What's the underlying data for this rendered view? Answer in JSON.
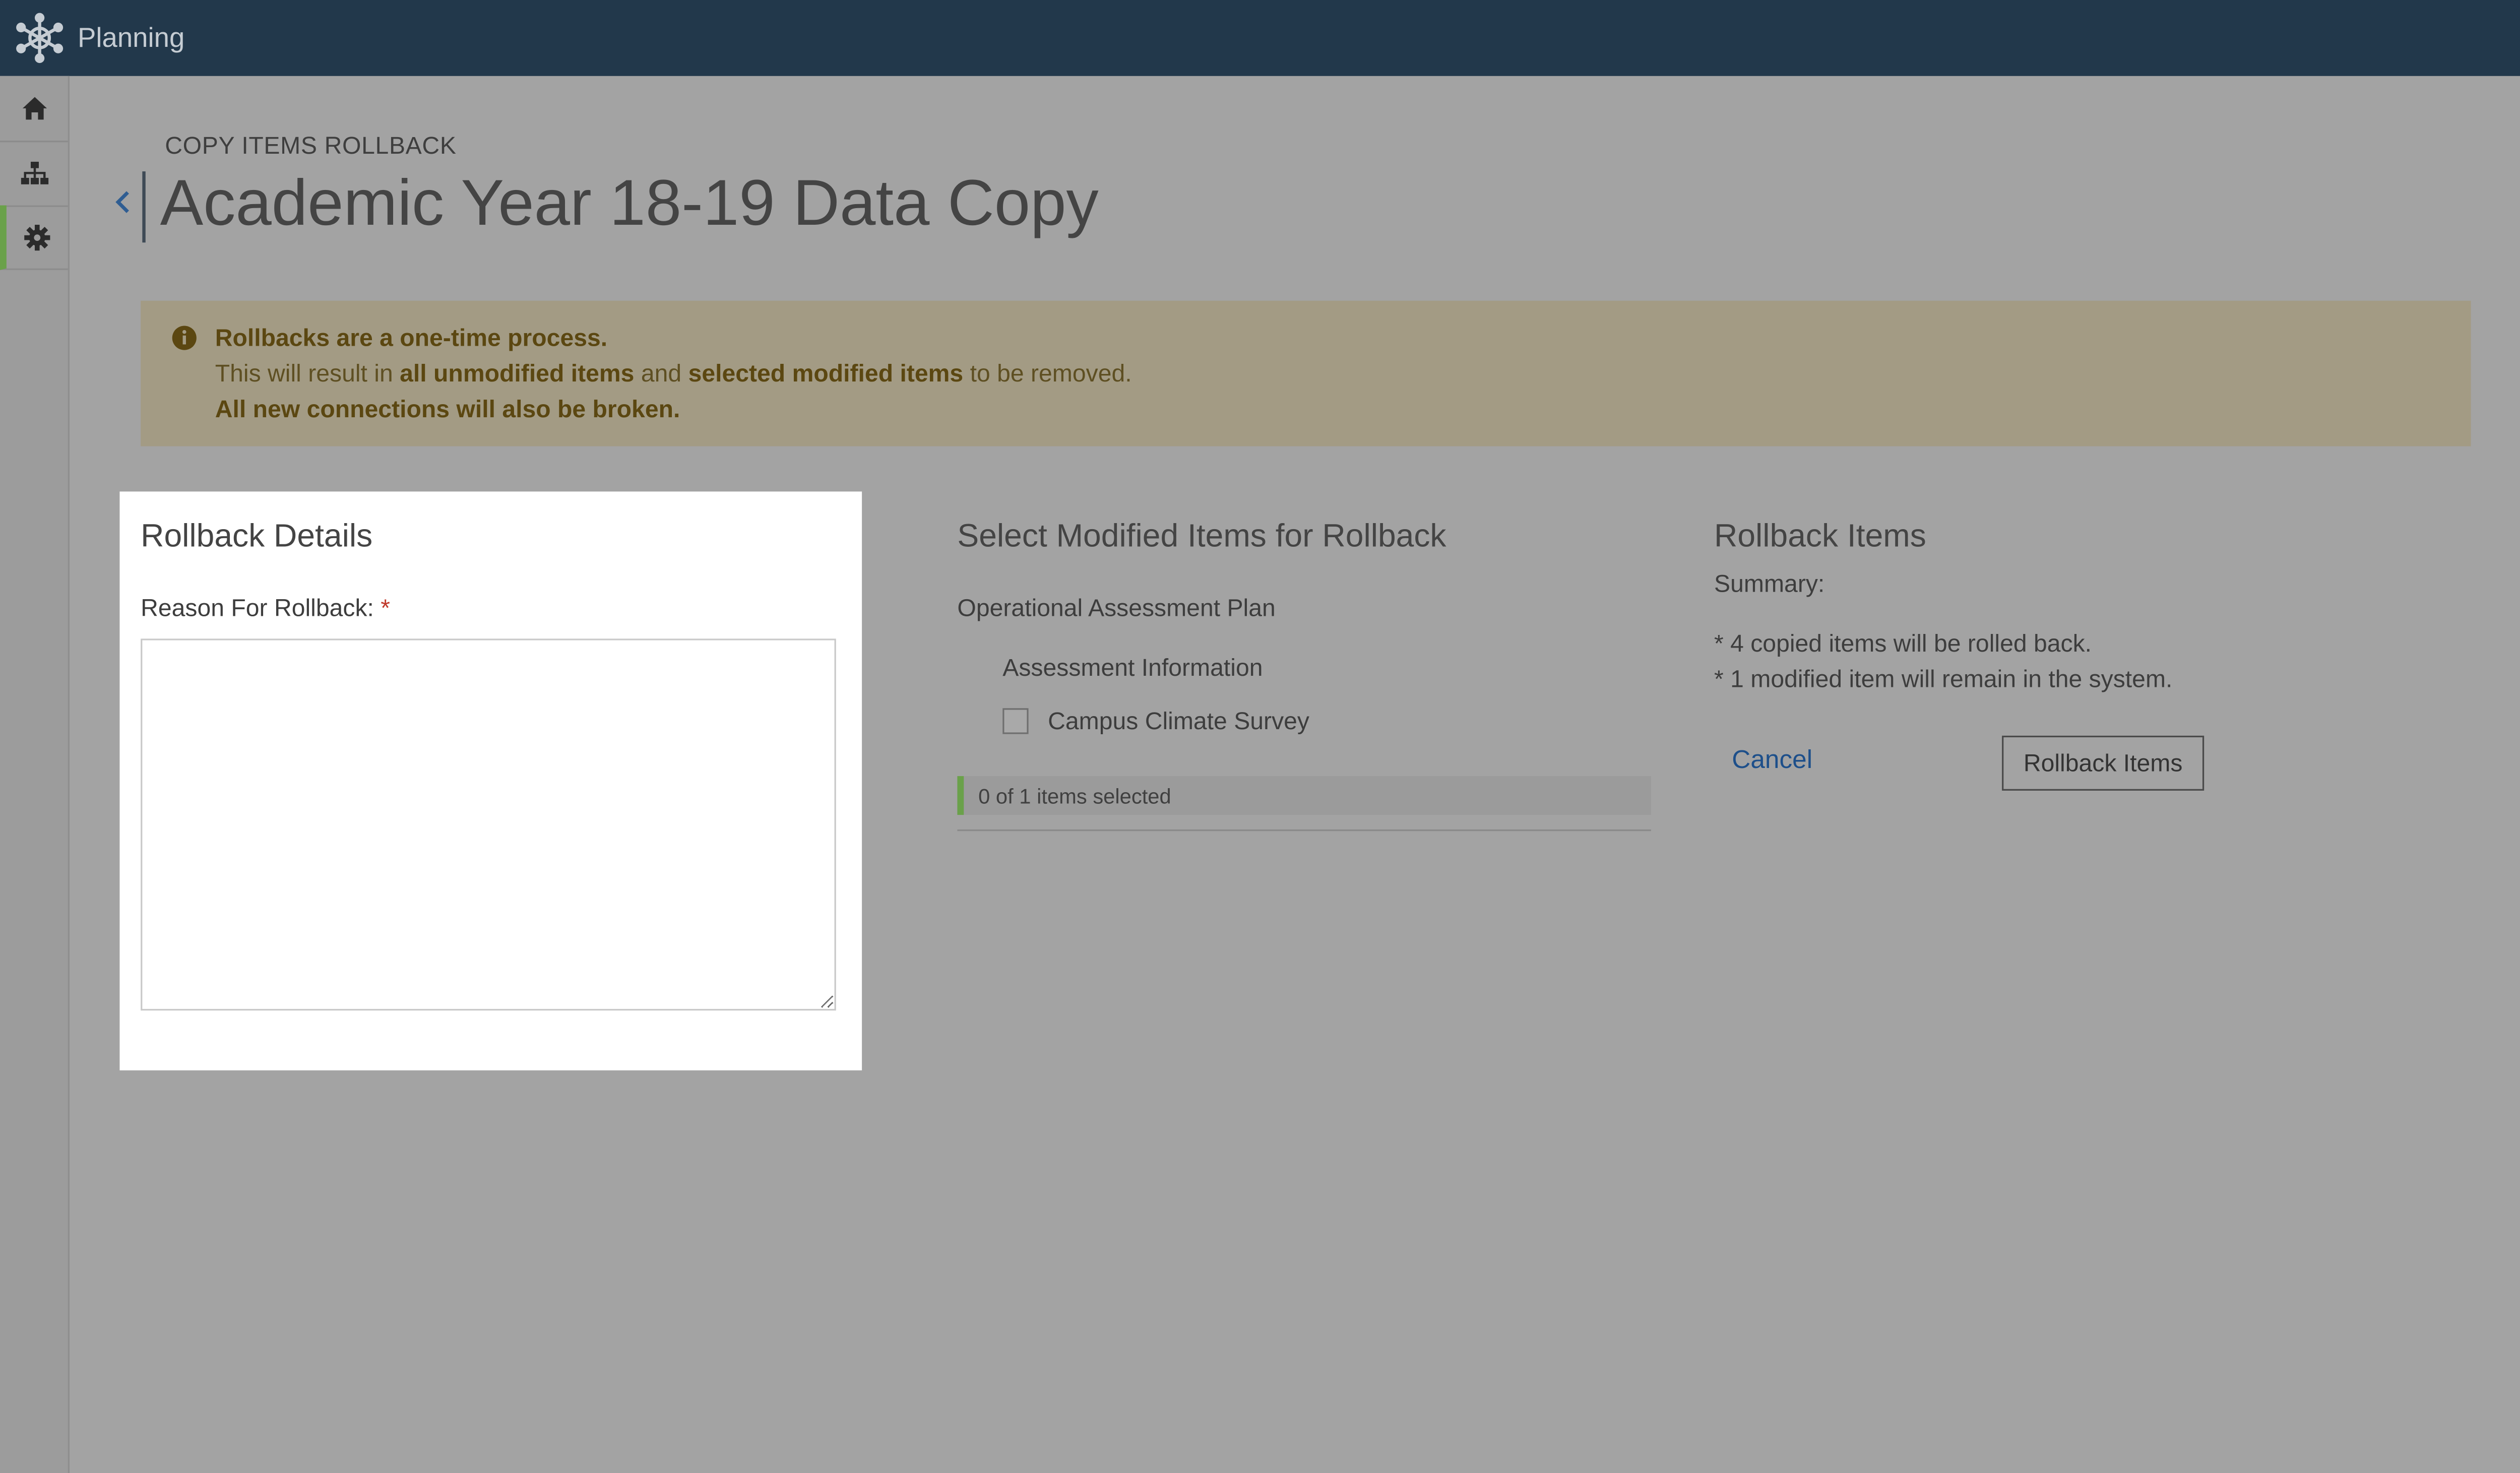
{
  "app": {
    "name": "Planning"
  },
  "sidebar": {
    "items": [
      {
        "icon": "home-icon",
        "active": false
      },
      {
        "icon": "sitemap-icon",
        "active": false
      },
      {
        "icon": "gear-icon",
        "active": true
      }
    ]
  },
  "page": {
    "breadcrumb": "COPY ITEMS ROLLBACK",
    "title": "Academic Year 18-19 Data Copy"
  },
  "alert": {
    "line1": "Rollbacks are a one-time process.",
    "line2_pre": "This will result in ",
    "line2_bold1": "all unmodified items",
    "line2_mid": " and ",
    "line2_bold2": "selected modified items",
    "line2_post": " to be removed.",
    "line3": "All new connections will also be broken."
  },
  "details": {
    "heading": "Rollback Details",
    "reason_label": "Reason For Rollback:",
    "required_mark": "*",
    "reason_value": ""
  },
  "select": {
    "heading": "Select Modified Items for Rollback",
    "group": "Operational Assessment Plan",
    "subgroup": "Assessment Information",
    "item": {
      "label": "Campus Climate Survey",
      "checked": false
    },
    "count_text": "0 of 1 items selected"
  },
  "summary": {
    "heading": "Rollback Items",
    "label": "Summary:",
    "line1": "* 4 copied items will be rolled back.",
    "line2": "* 1 modified item will remain in the system.",
    "cancel_label": "Cancel",
    "submit_label": "Rollback Items"
  },
  "colors": {
    "topbar": "#22384b",
    "accent_green": "#6aa14a",
    "link_blue": "#1d4f8a",
    "alert_bg": "#a39b84"
  }
}
